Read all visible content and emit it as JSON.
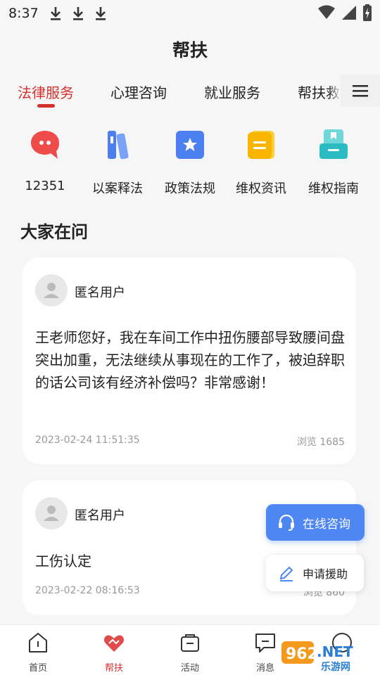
{
  "status_bar": {
    "time": "8:37"
  },
  "header": {
    "title": "帮扶"
  },
  "tabs": [
    {
      "label": "法律服务",
      "active": true
    },
    {
      "label": "心理咨询",
      "active": false
    },
    {
      "label": "就业服务",
      "active": false
    },
    {
      "label": "帮扶救",
      "active": false
    }
  ],
  "quick_actions": [
    {
      "label": "12351",
      "icon": "chat-bubble-icon",
      "color": "#ef4b4b"
    },
    {
      "label": "以案释法",
      "icon": "books-icon",
      "color": "#4c7ff0"
    },
    {
      "label": "政策法规",
      "icon": "star-document-icon",
      "color": "#4c7ff0"
    },
    {
      "label": "维权资讯",
      "icon": "news-icon",
      "color": "#f7b500"
    },
    {
      "label": "维权指南",
      "icon": "guide-box-icon",
      "color": "#2bbbc3"
    }
  ],
  "section": {
    "title": "大家在问"
  },
  "questions": [
    {
      "user": "匿名用户",
      "text": "王老师您好，我在车间工作中扭伤腰部导致腰间盘突出加重，无法继续从事现在的工作了，被迫辞职的话公司该有经济补偿吗？非常感谢！",
      "date": "2023-02-24 11:51:35",
      "views": "浏览  1685"
    },
    {
      "user": "匿名用户",
      "text": "工伤认定",
      "date": "2023-02-22 08:16:53",
      "views": "浏览  860"
    }
  ],
  "floating": {
    "consult_label": "在线咨询",
    "apply_label": "申请援助"
  },
  "bottom_nav": [
    {
      "label": "首页",
      "icon": "home-icon",
      "active": false
    },
    {
      "label": "帮扶",
      "icon": "heart-hands-icon",
      "active": true
    },
    {
      "label": "活动",
      "icon": "activity-bag-icon",
      "active": false
    },
    {
      "label": "消息",
      "icon": "message-icon",
      "active": false
    },
    {
      "label": "",
      "icon": "profile-icon",
      "active": false
    }
  ],
  "colors": {
    "accent": "#d6302d",
    "primary_blue": "#4e87f4"
  },
  "watermark": {
    "text": "962.NET",
    "subtext": "乐游网"
  }
}
